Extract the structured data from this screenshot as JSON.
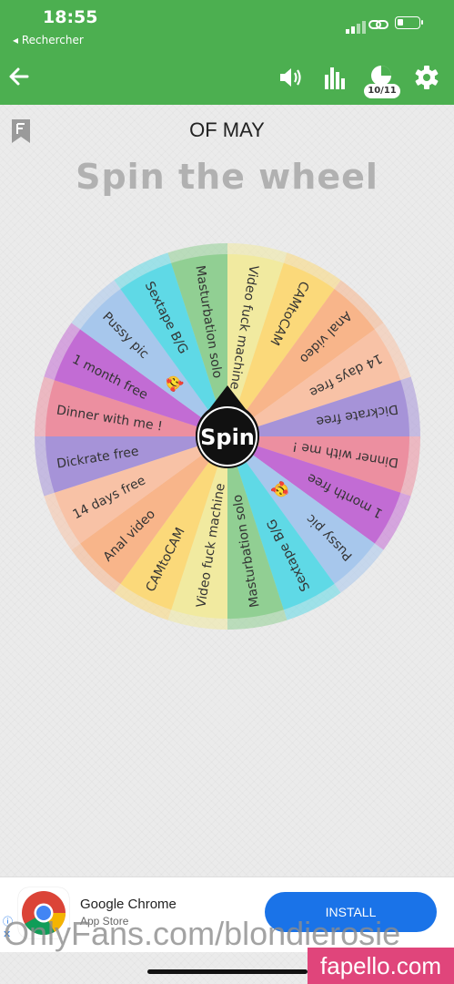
{
  "status_bar": {
    "time": "18:55",
    "back_label": "◂ Rechercher"
  },
  "toolbar": {
    "icons": [
      "back-arrow-icon",
      "volume-icon",
      "stats-icon",
      "pie-progress-icon",
      "gear-icon"
    ],
    "counter": "10/11",
    "accent": "#4caf50"
  },
  "list_title": "OF MAY",
  "heading": "Spin the wheel",
  "wheel": {
    "center_label": "Spin",
    "emoji": "🥰",
    "segments": [
      {
        "label": "Video fuck machine",
        "color": "#f1eaa0"
      },
      {
        "label": "CAMtoCAM",
        "color": "#fbd97a"
      },
      {
        "label": "Anal video",
        "color": "#f8b58a"
      },
      {
        "label": "14 days free",
        "color": "#f8c2a6"
      },
      {
        "label": "Dickrate free",
        "color": "#a693d8"
      },
      {
        "label": "Dinner with me !",
        "color": "#ec8fa0"
      },
      {
        "label": "1 month free",
        "color": "#c26cd4"
      },
      {
        "label": "Pussy pic",
        "color": "#a7c7ec"
      },
      {
        "label": "Sextape B/G",
        "color": "#5fd9e6"
      },
      {
        "label": "Masturbation solo",
        "color": "#91cf93"
      },
      {
        "label": "Video fuck machine",
        "color": "#f1eaa0"
      },
      {
        "label": "CAMtoCAM",
        "color": "#fbd97a"
      },
      {
        "label": "Anal video",
        "color": "#f8b58a"
      },
      {
        "label": "14 days free",
        "color": "#f8c2a6"
      },
      {
        "label": "Dickrate free",
        "color": "#a693d8"
      },
      {
        "label": "Dinner with me !",
        "color": "#ec8fa0"
      },
      {
        "label": "1 month free",
        "color": "#c26cd4"
      },
      {
        "label": "Pussy pic",
        "color": "#a7c7ec"
      },
      {
        "label": "Sextape B/G",
        "color": "#5fd9e6"
      },
      {
        "label": "Masturbation solo",
        "color": "#91cf93"
      }
    ]
  },
  "ad": {
    "title": "Google Chrome",
    "subtitle": "App Store",
    "button": "INSTALL",
    "button_color": "#1a73e8"
  },
  "watermark": {
    "left_text": "OnlyFans.com/blondierosie",
    "right_text": "fapello.com"
  }
}
